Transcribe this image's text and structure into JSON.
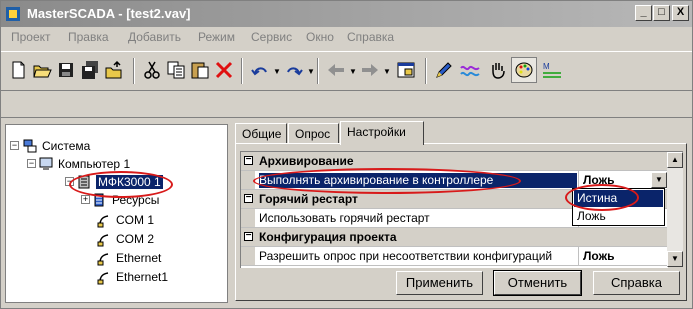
{
  "window": {
    "title": "MasterSCADA - [test2.vav]",
    "controls": [
      "_",
      "□",
      "X"
    ]
  },
  "menu": [
    "Проект",
    "Правка",
    "Добавить",
    "Режим",
    "Сервис",
    "Окно",
    "Справка"
  ],
  "toolbar": {
    "icons": [
      "new-icon",
      "open-icon",
      "save-icon",
      "save-all-icon",
      "folder-up-icon",
      "cut-icon",
      "copy-icon",
      "paste-icon",
      "delete-icon",
      "undo-icon",
      "redo-icon",
      "back-icon",
      "forward-icon",
      "window-icon",
      "pen-icon",
      "wave-icon",
      "hand-icon",
      "palette-icon",
      "chart-icon"
    ]
  },
  "tree": {
    "root": "Система",
    "computer": "Компьютер 1",
    "device": "МФК3000 1",
    "children": [
      "Ресурсы",
      "COM 1",
      "COM 2",
      "Ethernet",
      "Ethernet1"
    ]
  },
  "tabs": [
    "Общие",
    "Опрос",
    "Настройки"
  ],
  "active_tab": "Настройки",
  "properties": {
    "cat_archive": "Архивирование",
    "prop_archive": "Выполнять архивирование в контроллере",
    "val_archive": "Ложь",
    "cat_restart": "Горячий рестарт",
    "prop_restart": "Использовать горячий рестарт",
    "cat_config": "Конфигурация проекта",
    "prop_config": "Разрешить опрос при несоответствии конфигураций",
    "val_config": "Ложь"
  },
  "dropdown": {
    "options": [
      "Истина",
      "Ложь"
    ],
    "selected": "Истина"
  },
  "buttons": {
    "apply": "Применить",
    "cancel": "Отменить",
    "help": "Справка"
  },
  "colors": {
    "selection": "#0a246a",
    "highlight": "#d81a1a"
  }
}
